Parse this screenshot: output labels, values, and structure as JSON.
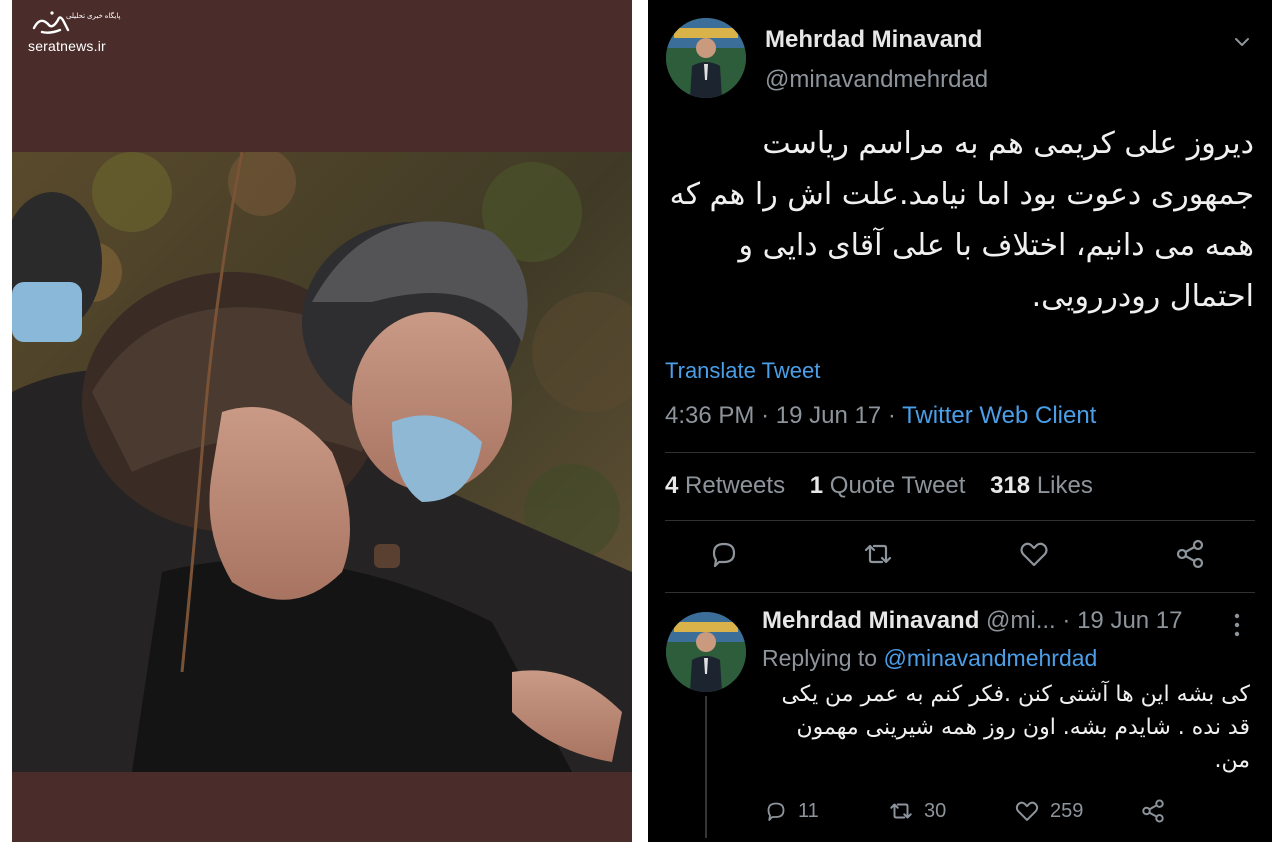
{
  "watermark": {
    "logo_text": "صراط",
    "tagline": "پایگاه خبری تحلیلی",
    "site": "seratnews.ir"
  },
  "tweet": {
    "display_name": "Mehrdad Minavand",
    "handle": "@minavandmehrdad",
    "text": "دیروز علی کریمی هم به مراسم ریاست جمهوری دعوت بود اما نیامد.علت اش را هم که همه می دانیم، اختلاف با علی آقای دایی و احتمال رودررویی.",
    "translate_label": "Translate Tweet",
    "time": "4:36 PM",
    "date": "19 Jun 17",
    "separator": "·",
    "source": "Twitter Web Client",
    "stats": {
      "retweets_count": "4",
      "retweets_label": "Retweets",
      "quotes_count": "1",
      "quotes_label": "Quote Tweet",
      "likes_count": "318",
      "likes_label": "Likes"
    },
    "action_icons": [
      "reply-icon",
      "retweet-icon",
      "like-icon",
      "share-icon"
    ]
  },
  "reply": {
    "display_name": "Mehrdad Minavand",
    "handle_truncated": "@mi...",
    "separator": "·",
    "date": "19 Jun 17",
    "replying_prefix": "Replying to",
    "replying_handle": "@minavandmehrdad",
    "text": "کی بشه این ها آشتی کنن .فکر کنم به عمر من یکی قد نده . شایدم بشه. اون روز همه شیرینی مهمون من.",
    "reply_count": "11",
    "retweet_count": "30",
    "like_count": "259"
  },
  "colors": {
    "tweet_background": "#000000",
    "link_blue": "#4a9fe8",
    "muted_gray": "#8d949b",
    "left_background": "#4a2d2a"
  }
}
